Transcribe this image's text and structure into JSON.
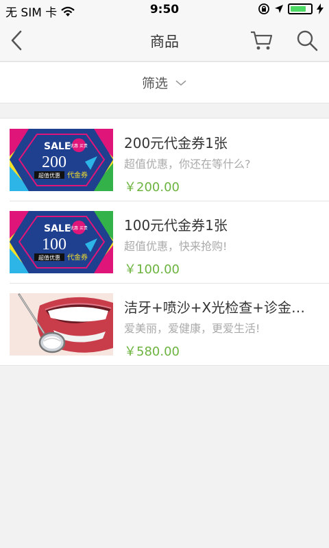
{
  "status_bar": {
    "carrier": "无 SIM 卡",
    "time": "9:50",
    "battery_level": 0.8,
    "icons": [
      "wifi-icon",
      "orientation-lock-icon",
      "location-arrow-icon",
      "battery-icon",
      "charging-bolt-icon"
    ]
  },
  "nav": {
    "title": "商品",
    "icons": [
      "back-chevron-icon",
      "cart-icon",
      "search-icon"
    ]
  },
  "filter": {
    "label": "筛选",
    "icon": "chevron-down-icon"
  },
  "products": [
    {
      "title": "200元代金券1张",
      "subtitle": "超值优惠，你还在等什么?",
      "price": "￥200.00",
      "thumb": {
        "sale": "SALE",
        "badge": "优惠 买贵",
        "amount": "200",
        "tag_left": "超值优惠",
        "tag_right": "代金券"
      }
    },
    {
      "title": "100元代金券1张",
      "subtitle": "超值优惠，快来抢购!",
      "price": "￥100.00",
      "thumb": {
        "sale": "SALE",
        "badge": "优惠 买贵",
        "amount": "100",
        "tag_left": "超值优惠",
        "tag_right": "代金券"
      }
    },
    {
      "title": "洁牙+喷沙+X光检查+诊金…",
      "subtitle": "爱美丽，爱健康，更爱生活!",
      "price": "￥580.00",
      "thumb": {
        "image": "teeth-smile-with-dental-mirror"
      }
    }
  ],
  "colors": {
    "price": "#6cb33f",
    "coupon_navy": "#1f3f8f",
    "coupon_pink": "#e0157a",
    "coupon_yellow": "#f3e12a"
  }
}
